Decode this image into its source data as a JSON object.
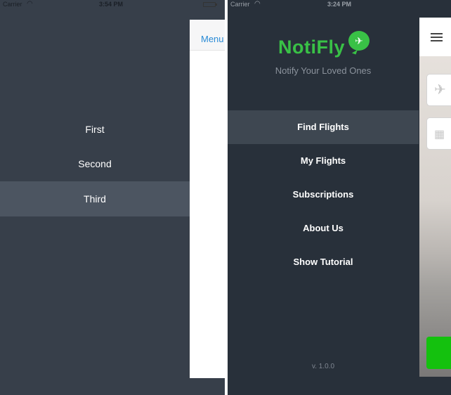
{
  "left_phone": {
    "status": {
      "carrier": "Carrier",
      "time": "3:54 PM"
    },
    "menu_items": [
      {
        "label": "First",
        "active": false
      },
      {
        "label": "Second",
        "active": false
      },
      {
        "label": "Third",
        "active": true
      }
    ],
    "content": {
      "menu_link": "Menu"
    }
  },
  "right_phone": {
    "status": {
      "carrier": "Carrier",
      "time": "3:24 PM"
    },
    "logo": {
      "text": "NotiFly",
      "icon": "airplane-icon",
      "color": "#39c146"
    },
    "tagline": "Notify Your Loved Ones",
    "menu_items": [
      {
        "label": "Find Flights",
        "active": true
      },
      {
        "label": "My Flights",
        "active": false
      },
      {
        "label": "Subscriptions",
        "active": false
      },
      {
        "label": "About Us",
        "active": false
      },
      {
        "label": "Show Tutorial",
        "active": false
      }
    ],
    "version": "v. 1.0.0",
    "content": {
      "icons": [
        "hamburger-menu-icon",
        "airplane-icon",
        "calendar-icon"
      ],
      "accent_color": "#14c10e"
    }
  }
}
